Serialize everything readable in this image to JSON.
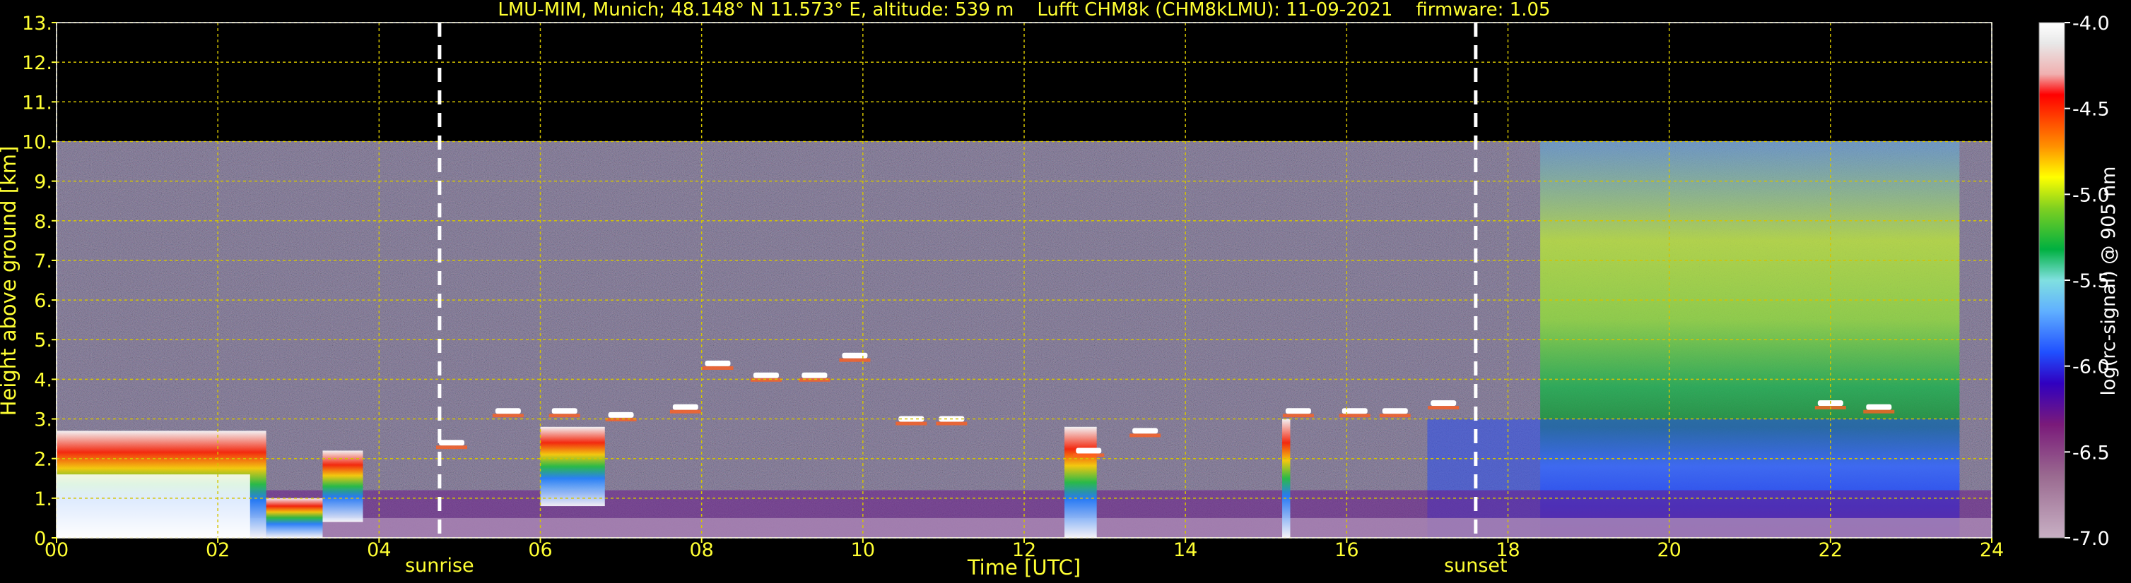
{
  "chart_data": {
    "type": "heatmap",
    "title": "LMU-MIM, Munich; 48.148° N 11.573° E, altitude: 539 m    Lufft CHM8k (CHM8kLMU): 11-09-2021    firmware: 1.05",
    "xlabel": "Time [UTC]",
    "ylabel": "Height above ground [km]",
    "x_ticks": [
      "00",
      "02",
      "04",
      "06",
      "08",
      "10",
      "12",
      "14",
      "16",
      "18",
      "20",
      "22",
      "24"
    ],
    "y_ticks": [
      "0.",
      "1.",
      "2.",
      "3.",
      "4.",
      "5.",
      "6.",
      "7.",
      "8.",
      "9.",
      "10.",
      "11.",
      "12.",
      "13."
    ],
    "xlim": [
      0,
      24
    ],
    "ylim": [
      0,
      13
    ],
    "grid": true,
    "data_top_km": 10,
    "markers": [
      {
        "label": "sunrise",
        "time_h": 4.75
      },
      {
        "label": "sunset",
        "time_h": 17.6
      }
    ],
    "colorbar": {
      "label": "log(rc-signal) @ 905 nm",
      "range": [
        -7.0,
        -4.0
      ],
      "ticks": [
        "-4.0",
        "-4.5",
        "-5.0",
        "-5.5",
        "-6.0",
        "-6.5",
        "-7.0"
      ]
    },
    "features": {
      "low_clouds": [
        {
          "t0": 0.0,
          "t1": 2.6,
          "top": 2.7,
          "base": 0.0
        },
        {
          "t0": 2.6,
          "t1": 3.3,
          "top": 1.0,
          "base": 0.0
        },
        {
          "t0": 3.3,
          "t1": 3.8,
          "top": 2.2,
          "base": 0.4
        },
        {
          "t0": 6.0,
          "t1": 6.8,
          "top": 2.8,
          "base": 0.8
        },
        {
          "t0": 12.5,
          "t1": 12.9,
          "top": 2.8,
          "base": 0.0
        },
        {
          "t0": 15.2,
          "t1": 15.3,
          "top": 3.0,
          "base": 0.0
        }
      ],
      "cloud_layer_points": [
        [
          4.9,
          2.4
        ],
        [
          5.6,
          3.2
        ],
        [
          6.3,
          3.2
        ],
        [
          7.0,
          3.1
        ],
        [
          7.8,
          3.3
        ],
        [
          8.2,
          4.4
        ],
        [
          8.8,
          4.1
        ],
        [
          9.4,
          4.1
        ],
        [
          9.9,
          4.6
        ],
        [
          10.6,
          3.0
        ],
        [
          11.1,
          3.0
        ],
        [
          12.8,
          2.2
        ],
        [
          13.5,
          2.7
        ],
        [
          15.4,
          3.2
        ],
        [
          16.1,
          3.2
        ],
        [
          16.6,
          3.2
        ],
        [
          17.2,
          3.4
        ],
        [
          22.0,
          3.4
        ],
        [
          22.6,
          3.3
        ]
      ],
      "night_aerosol": {
        "t0": 18.4,
        "t1": 23.6,
        "top": 10.0
      }
    },
    "colors": {
      "axis": "#ffff33",
      "grid": "#d4c400",
      "background": "#000000"
    }
  }
}
